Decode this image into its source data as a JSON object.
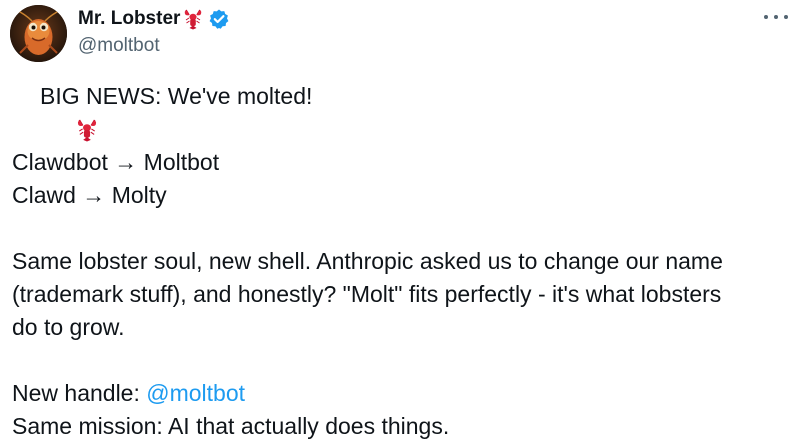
{
  "author": {
    "display_name": "Mr. Lobster",
    "handle": "@moltbot",
    "name_emoji": "lobster-icon",
    "verified": true,
    "verified_color": "#1d9bf0"
  },
  "more_menu_icon": "more-horizontal-icon",
  "post": {
    "headline_emoji": "lobster-icon",
    "headline": "BIG NEWS: We've molted!",
    "rename_lines": [
      "Clawdbot → Moltbot",
      "Clawd → Molty"
    ],
    "paragraph_lines": [
      "Same lobster soul, new shell. Anthropic asked us to change our name",
      "(trademark stuff), and honestly? \"Molt\" fits perfectly - it's what lobsters",
      "do to grow."
    ],
    "new_handle_label": "New handle: ",
    "new_handle_mention": "@moltbot",
    "mission_line": "Same mission: AI that actually does things."
  },
  "colors": {
    "text": "#0f1419",
    "secondary": "#536471",
    "link": "#1d9bf0"
  }
}
